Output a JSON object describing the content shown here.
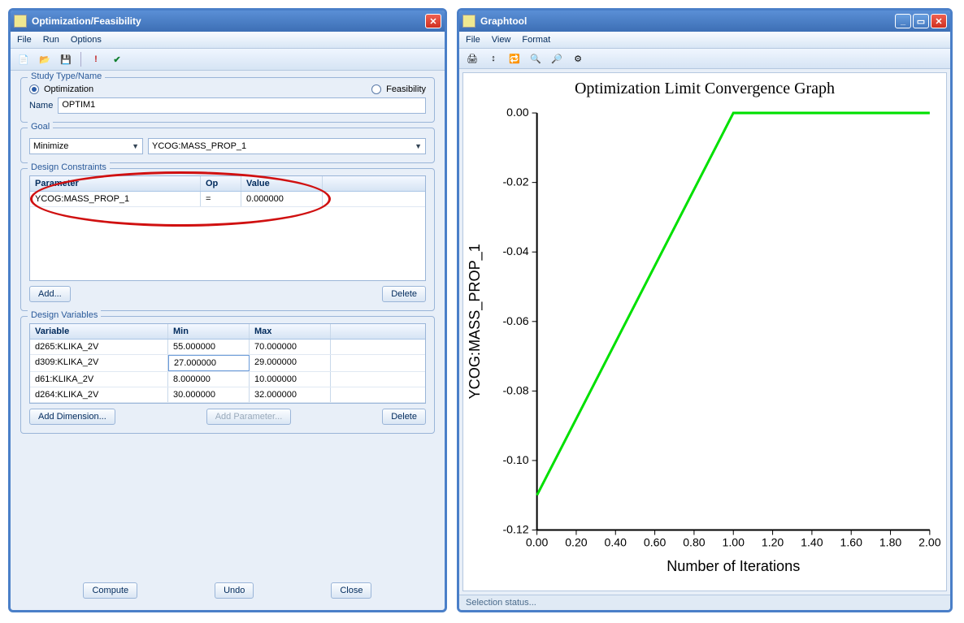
{
  "left": {
    "title": "Optimization/Feasibility",
    "menu": [
      "File",
      "Run",
      "Options"
    ],
    "study": {
      "legend": "Study Type/Name",
      "opt_label": "Optimization",
      "feas_label": "Feasibility",
      "name_label": "Name",
      "name_value": "OPTIM1"
    },
    "goal": {
      "legend": "Goal",
      "type": "Minimize",
      "param": "YCOG:MASS_PROP_1"
    },
    "constraints": {
      "legend": "Design Constraints",
      "headers": {
        "param": "Parameter",
        "op": "Op",
        "val": "Value"
      },
      "rows": [
        {
          "param": "YCOG:MASS_PROP_1",
          "op": "=",
          "val": "0.000000"
        }
      ],
      "add": "Add...",
      "delete": "Delete"
    },
    "variables": {
      "legend": "Design Variables",
      "headers": {
        "variable": "Variable",
        "min": "Min",
        "max": "Max"
      },
      "rows": [
        {
          "var": "d265:KLIKA_2V",
          "min": "55.000000",
          "max": "70.000000"
        },
        {
          "var": "d309:KLIKA_2V",
          "min": "27.000000",
          "max": "29.000000"
        },
        {
          "var": "d61:KLIKA_2V",
          "min": "8.000000",
          "max": "10.000000"
        },
        {
          "var": "d264:KLIKA_2V",
          "min": "30.000000",
          "max": "32.000000"
        }
      ],
      "add_dim": "Add Dimension...",
      "add_param": "Add Parameter...",
      "delete": "Delete"
    },
    "buttons": {
      "compute": "Compute",
      "undo": "Undo",
      "close": "Close"
    }
  },
  "right": {
    "title": "Graphtool",
    "menu": [
      "File",
      "View",
      "Format"
    ],
    "status": "Selection status..."
  },
  "chart_data": {
    "type": "line",
    "title": "Optimization Limit Convergence Graph",
    "xlabel": "Number of Iterations",
    "ylabel": "YCOG:MASS_PROP_1",
    "xlim": [
      0,
      2
    ],
    "ylim": [
      -0.12,
      0
    ],
    "x_ticks": [
      0.0,
      0.2,
      0.4,
      0.6,
      0.8,
      1.0,
      1.2,
      1.4,
      1.6,
      1.8,
      2.0
    ],
    "y_ticks": [
      0.0,
      -0.02,
      -0.04,
      -0.06,
      -0.08,
      -0.1,
      -0.12
    ],
    "series": [
      {
        "name": "YCOG:MASS_PROP_1",
        "color": "#00e000",
        "x": [
          0,
          1,
          2
        ],
        "y": [
          -0.11,
          0.0,
          0.0
        ]
      }
    ]
  }
}
